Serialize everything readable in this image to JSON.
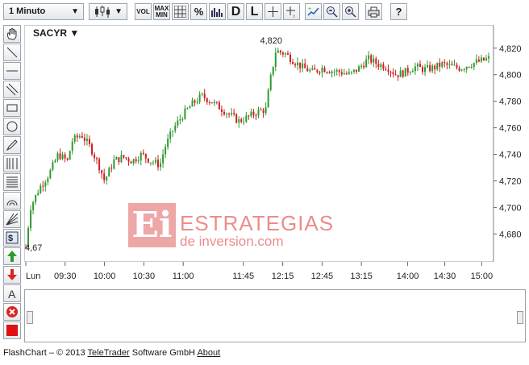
{
  "toolbar": {
    "interval_select": "1 Minuto",
    "vol_label": "VOL",
    "maxmin_label": "MAX MIN",
    "percent_label": "%",
    "d_label": "D",
    "l_label": "L",
    "help_label": "?"
  },
  "ticker": "SACYR ▼",
  "watermark": {
    "line1": "ESTRATEGIAS",
    "line2": "de inversion.com",
    "logo": "Ei"
  },
  "footer": {
    "prefix": "FlashChart – © 2013 ",
    "company": "TeleTrader",
    "middle": " Software GmbH ",
    "about": "About"
  },
  "colors": {
    "up": "#2e9a2e",
    "down": "#cc2020",
    "axis": "#333333",
    "navigator_line": "#1e3a5f",
    "navigator_fill": "#eef3f9"
  },
  "chart_data": {
    "type": "candlestick",
    "title": "SACYR",
    "x_ticks": [
      "Lun",
      "09:30",
      "10:00",
      "10:30",
      "11:00",
      "11:45",
      "12:15",
      "12:45",
      "13:15",
      "14:00",
      "14:30",
      "15:00"
    ],
    "y_ticks": [
      "4,680",
      "4,700",
      "4,720",
      "4,740",
      "4,760",
      "4,780",
      "4,800",
      "4,820"
    ],
    "ylim": [
      4.662,
      4.832
    ],
    "annotations": [
      {
        "label": "4,820",
        "x": 0.53,
        "y": 4.82
      },
      {
        "label": "4,67",
        "x": 0.0,
        "y": 4.67
      }
    ],
    "grid": false,
    "price_path": [
      [
        0.0,
        4.67
      ],
      [
        0.01,
        4.7
      ],
      [
        0.03,
        4.715
      ],
      [
        0.05,
        4.725
      ],
      [
        0.07,
        4.74
      ],
      [
        0.09,
        4.735
      ],
      [
        0.1,
        4.75
      ],
      [
        0.12,
        4.755
      ],
      [
        0.14,
        4.745
      ],
      [
        0.16,
        4.73
      ],
      [
        0.17,
        4.72
      ],
      [
        0.19,
        4.735
      ],
      [
        0.21,
        4.738
      ],
      [
        0.23,
        4.735
      ],
      [
        0.25,
        4.74
      ],
      [
        0.27,
        4.735
      ],
      [
        0.29,
        4.732
      ],
      [
        0.3,
        4.745
      ],
      [
        0.32,
        4.76
      ],
      [
        0.34,
        4.77
      ],
      [
        0.36,
        4.778
      ],
      [
        0.38,
        4.784
      ],
      [
        0.4,
        4.78
      ],
      [
        0.42,
        4.775
      ],
      [
        0.44,
        4.77
      ],
      [
        0.46,
        4.765
      ],
      [
        0.48,
        4.768
      ],
      [
        0.5,
        4.772
      ],
      [
        0.52,
        4.774
      ],
      [
        0.525,
        4.79
      ],
      [
        0.54,
        4.818
      ],
      [
        0.56,
        4.816
      ],
      [
        0.58,
        4.81
      ],
      [
        0.6,
        4.805
      ],
      [
        0.62,
        4.802
      ],
      [
        0.64,
        4.805
      ],
      [
        0.66,
        4.803
      ],
      [
        0.68,
        4.802
      ],
      [
        0.7,
        4.8
      ],
      [
        0.72,
        4.805
      ],
      [
        0.74,
        4.812
      ],
      [
        0.76,
        4.808
      ],
      [
        0.78,
        4.806
      ],
      [
        0.8,
        4.8
      ],
      [
        0.82,
        4.802
      ],
      [
        0.84,
        4.806
      ],
      [
        0.86,
        4.804
      ],
      [
        0.88,
        4.805
      ],
      [
        0.9,
        4.808
      ],
      [
        0.92,
        4.806
      ],
      [
        0.94,
        4.805
      ],
      [
        0.96,
        4.808
      ],
      [
        0.98,
        4.81
      ],
      [
        1.0,
        4.812
      ]
    ]
  }
}
